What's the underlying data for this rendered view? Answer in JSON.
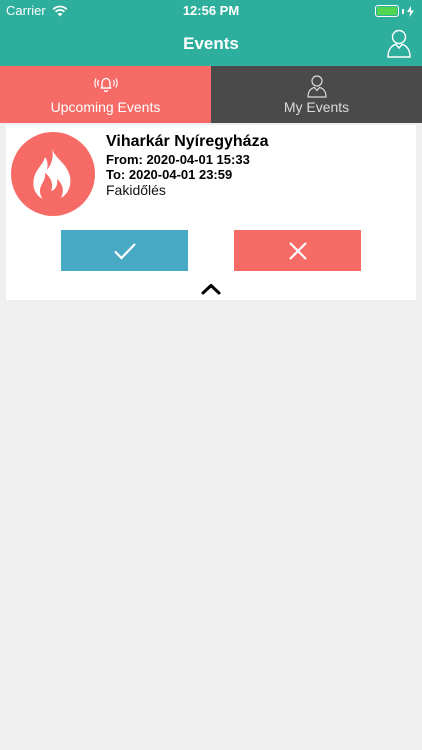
{
  "status_bar": {
    "carrier": "Carrier",
    "time": "12:56 PM"
  },
  "nav": {
    "title": "Events",
    "profile_icon": "person-outline-icon"
  },
  "tabs": [
    {
      "label": "Upcoming Events",
      "icon": "bell-ringing-icon",
      "active": true
    },
    {
      "label": "My Events",
      "icon": "person-outline-icon",
      "active": false
    }
  ],
  "event": {
    "title": "Viharkár Nyíregyháza",
    "from": "From: 2020-04-01 15:33",
    "to": "To: 2020-04-01 23:59",
    "description": "Fakidőlés",
    "icon": "fire-icon"
  },
  "actions": {
    "accept_icon": "checkmark-icon",
    "decline_icon": "close-icon",
    "collapse_icon": "chevron-up-icon"
  },
  "colors": {
    "header": "#2eaf9e",
    "active_tab": "#f76b67",
    "inactive_tab": "#4a4a4a",
    "accept": "#48a9c5",
    "decline": "#f76b67",
    "background": "#efefef"
  }
}
